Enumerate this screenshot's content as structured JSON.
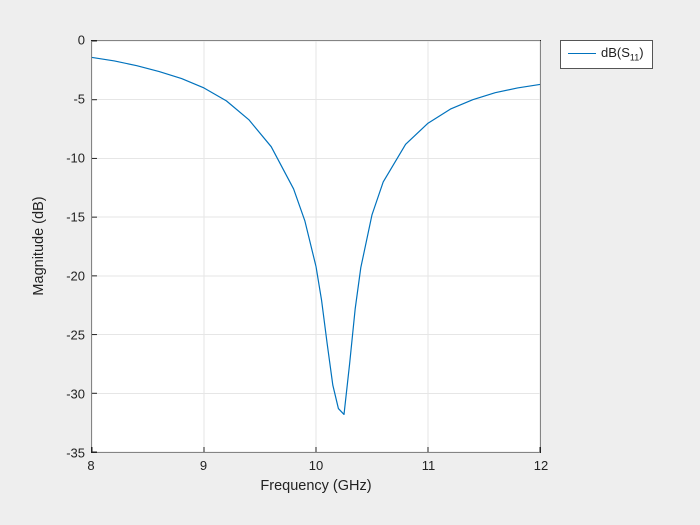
{
  "chart_data": {
    "type": "line",
    "title": "",
    "xlabel": "Frequency (GHz)",
    "ylabel": "Magnitude (dB)",
    "xlim": [
      8,
      12
    ],
    "ylim": [
      -35,
      0
    ],
    "xticks": [
      8,
      9,
      10,
      11,
      12
    ],
    "yticks": [
      -35,
      -30,
      -25,
      -20,
      -15,
      -10,
      -5,
      0
    ],
    "grid": true,
    "legend_position": "outside-right-top",
    "series": [
      {
        "name": "dB(S_{11})",
        "legend_html": "dB(S<sub>11</sub>)",
        "color": "#0072BD",
        "x": [
          8.0,
          8.2,
          8.4,
          8.6,
          8.8,
          9.0,
          9.2,
          9.4,
          9.6,
          9.8,
          9.9,
          10.0,
          10.05,
          10.1,
          10.15,
          10.2,
          10.25,
          10.3,
          10.35,
          10.4,
          10.5,
          10.6,
          10.8,
          11.0,
          11.2,
          11.4,
          11.6,
          11.8,
          12.0
        ],
        "y": [
          -1.4,
          -1.7,
          -2.1,
          -2.6,
          -3.2,
          -4.0,
          -5.1,
          -6.7,
          -9.0,
          -12.6,
          -15.3,
          -19.2,
          -22.1,
          -25.8,
          -29.3,
          -31.3,
          -31.8,
          -27.5,
          -22.8,
          -19.3,
          -14.8,
          -12.0,
          -8.8,
          -7.0,
          -5.8,
          -5.0,
          -4.4,
          -4.0,
          -3.7
        ]
      }
    ]
  },
  "labels": {
    "xlabel": "Frequency (GHz)",
    "ylabel": "Magnitude (dB)",
    "legend_text": "dB(S"
  },
  "legend": {
    "sub": "11",
    "close_paren": ")"
  }
}
